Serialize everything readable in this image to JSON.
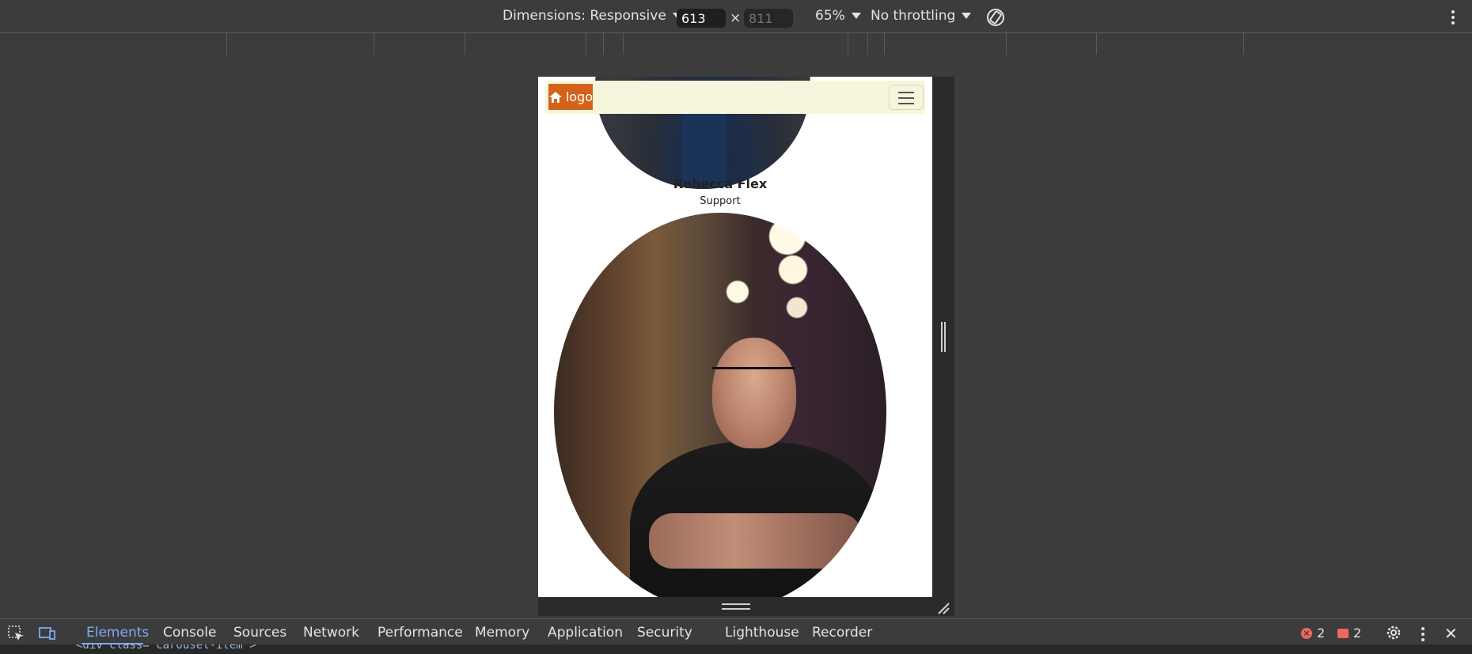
{
  "toolbar": {
    "dimensions_label": "Dimensions: Responsive",
    "width_value": "613",
    "height_placeholder": "811",
    "times": "×",
    "zoom_label": "65%",
    "throttle_label": "No throttling",
    "rotate_icon": "rotate-icon",
    "more_icon": "kebab-icon"
  },
  "page": {
    "logo_text": "logo",
    "logo_icon": "home-icon",
    "menu_icon": "hamburger-icon",
    "person1_name": "Rebecca Flex",
    "person1_role": "Support",
    "accent": "#d3631b",
    "navbar_bg": "#f6f6dc"
  },
  "devtools": {
    "tabs": [
      "Elements",
      "Console",
      "Sources",
      "Network",
      "Performance",
      "Memory",
      "Application",
      "Security",
      "Lighthouse",
      "Recorder"
    ],
    "active_tab": "Elements",
    "errors": "2",
    "warnings": "2",
    "code_snippet": "<div class=\"carousel-item\">"
  }
}
